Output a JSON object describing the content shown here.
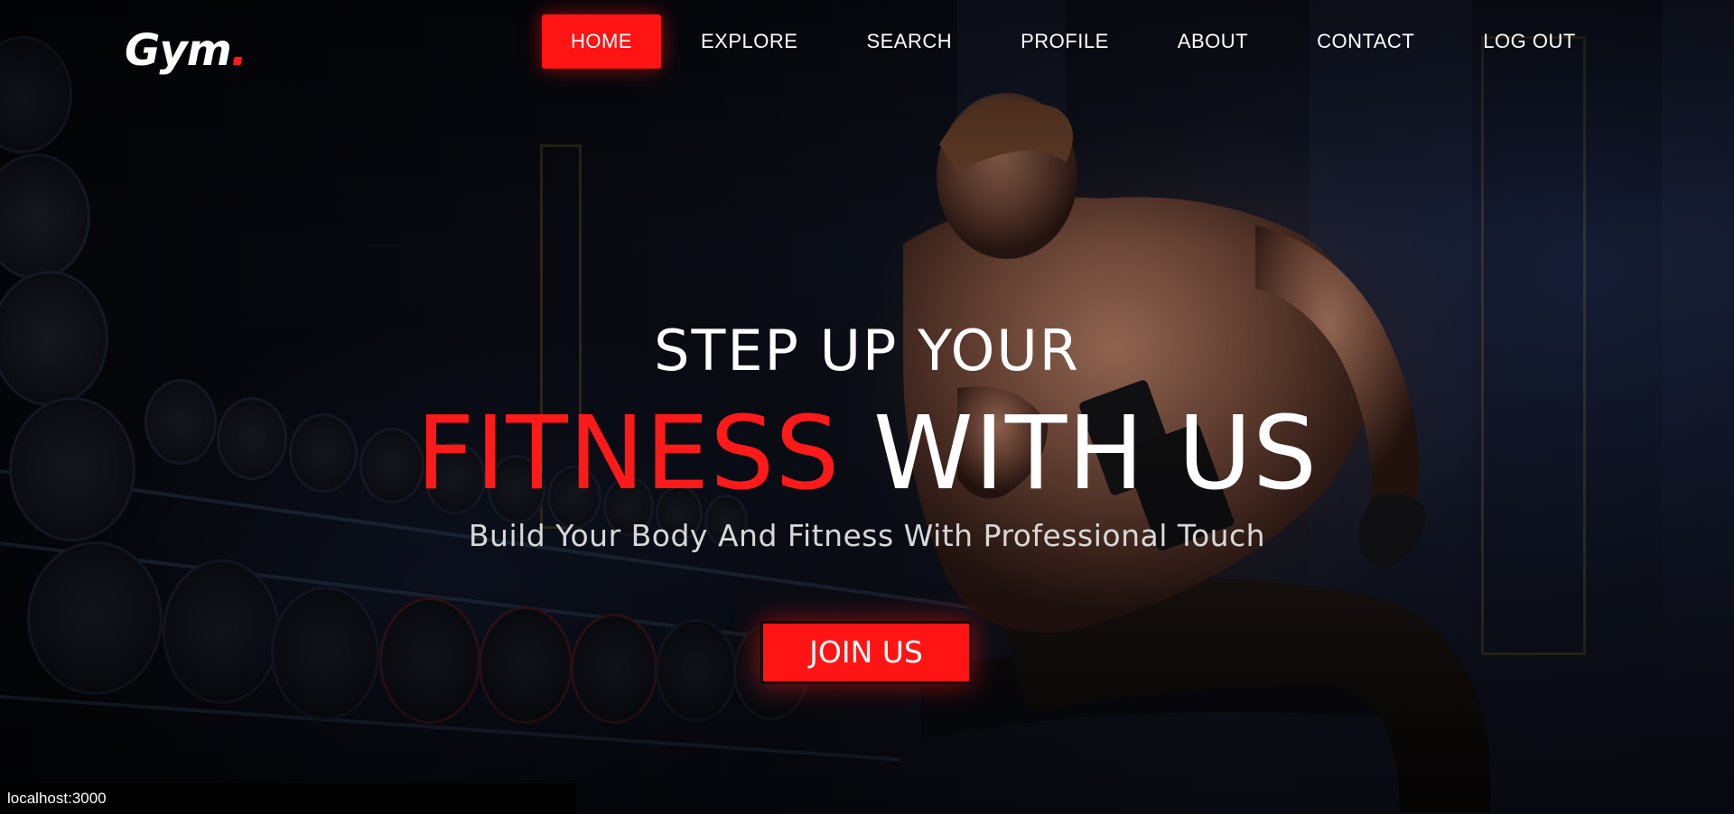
{
  "brand": {
    "logo_text": "Gym",
    "logo_dot": "."
  },
  "nav": {
    "items": [
      {
        "label": "HOME",
        "active": true
      },
      {
        "label": "EXPLORE",
        "active": false
      },
      {
        "label": "SEARCH",
        "active": false
      },
      {
        "label": "PROFILE",
        "active": false
      },
      {
        "label": "ABOUT",
        "active": false
      },
      {
        "label": "CONTACT",
        "active": false
      },
      {
        "label": "LOG OUT",
        "active": false
      }
    ]
  },
  "hero": {
    "headline_top": "STEP UP YOUR",
    "headline_accent": "FITNESS",
    "headline_rest": " WITH US",
    "subline": "Build Your Body And Fitness With Professional Touch",
    "cta_label": "JOIN US"
  },
  "status_bar": {
    "url": "localhost:3000"
  },
  "colors": {
    "accent": "#ff1414",
    "background": "#07080c",
    "text": "#ffffff"
  }
}
